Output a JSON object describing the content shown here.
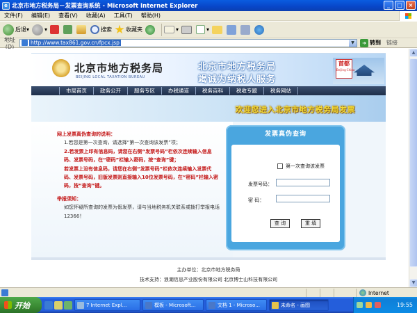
{
  "window": {
    "title": "北京市地方税务局－发票查询系统 - Microsoft Internet Explorer",
    "controls": [
      "_",
      "□",
      "×"
    ]
  },
  "menu": [
    "文件(F)",
    "编辑(E)",
    "查看(V)",
    "收藏(A)",
    "工具(T)",
    "帮助(H)"
  ],
  "toolbar": {
    "back_label": "后退",
    "search_label": "搜索",
    "favorites_label": "收藏夹"
  },
  "address": {
    "label": "地址(D)",
    "url": "http://www.tax861.gov.cn/fpcx.jsp",
    "go_label": "转到",
    "links_label": "链接"
  },
  "banner": {
    "bureau_name": "北京市地方税务局",
    "bureau_name_en": "BEIJING LOCAL TAXATION BUREAU",
    "slogan_line1": "北京市地方税务局",
    "slogan_line2": "竭诚为纳税人服务",
    "badge_text": "首都",
    "badge_sub": "Beijing·China"
  },
  "nav": [
    "市局首页",
    "政务公开",
    "服务专区",
    "办税通道",
    "税务百科",
    "税收专题",
    "税务网站"
  ],
  "welcome": "欢迎您进入北京市地方税务局发票",
  "instructions": {
    "heading": "网上发票真伪查询的说明：",
    "item1": "1.若您是第一次查询，请选择“第一次查询该发票”项；",
    "item2": "2.若发票上印有信息码，请您在右侧“发票号码”栏依次连续输入信息码、发票号码，在“密码”栏输入密码，按“查询”键；",
    "item3": "若发票上没有信息码，请您在右侧“发票号码”栏依次连续输入发票代码、发票号码，旧版发票则直接输入10位发票号码，在“密码”栏输入密码，按“查询”键。",
    "report_heading": "举报须知：",
    "report_text": "如您怀疑所查询的发票为假发票，请与当地税务机关联系或拨打举报电话12366！"
  },
  "query_panel": {
    "title": "发票真伪查询",
    "first_time_label": "第一次查询该发票",
    "invoice_label": "发票号码：",
    "invoice_value": "",
    "password_label": "密    码：",
    "password_value": "",
    "query_button": "查 询",
    "reset_button": "重 填"
  },
  "footer": {
    "sponsor": "主办单位：北京市地方税务局",
    "support": "技术支持：浪潮信息产业股份有限公司  北京博士山科技有限公司"
  },
  "status": {
    "zone": "Internet"
  },
  "taskbar": {
    "start": "开始",
    "tasks": [
      "7 Internet Expl...",
      "模板 - Microsoft...",
      "文档 1 - Microso...",
      "未命名 - 画图"
    ],
    "clock": "19:55"
  }
}
